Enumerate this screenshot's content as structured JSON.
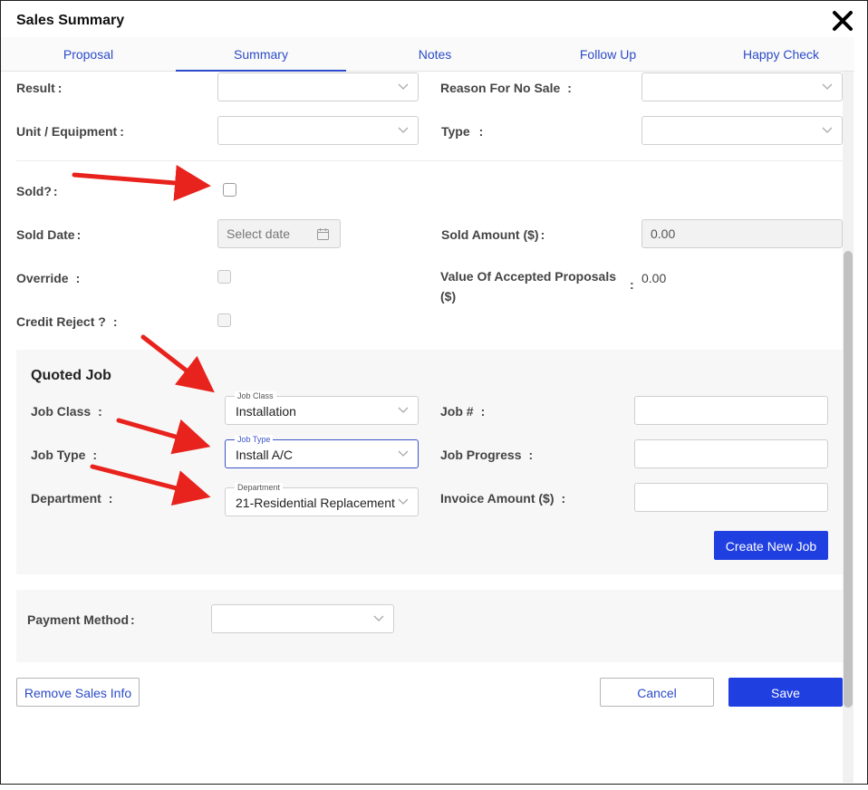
{
  "header": {
    "title": "Sales Summary",
    "close_icon": "close-icon"
  },
  "tabs": [
    {
      "label": "Proposal"
    },
    {
      "label": "Summary",
      "active": true
    },
    {
      "label": "Notes"
    },
    {
      "label": "Follow Up"
    },
    {
      "label": "Happy Check"
    }
  ],
  "form": {
    "result_label": "Result",
    "reason_label": "Reason For No Sale",
    "unit_label": "Unit / Equipment",
    "type_label": "Type",
    "sold_label": "Sold?",
    "sold_date_label": "Sold Date",
    "sold_date_placeholder": "Select date",
    "sold_amount_label": "Sold Amount ($)",
    "sold_amount_value": "0.00",
    "override_label": "Override",
    "value_accepted_label_1": "Value Of Accepted Proposals",
    "value_accepted_label_2": "($)",
    "value_accepted_value": "0.00",
    "credit_reject_label": "Credit Reject ?",
    "colon": ":"
  },
  "quoted_job": {
    "title": "Quoted Job",
    "job_class_label": "Job Class",
    "job_class_float": "Job Class",
    "job_class_value": "Installation",
    "job_type_label": "Job Type",
    "job_type_float": "Job Type",
    "job_type_value": "Install A/C",
    "department_label": "Department",
    "department_float": "Department",
    "department_value": "21-Residential Replacement",
    "job_no_label": "Job #",
    "job_progress_label": "Job Progress",
    "invoice_amount_label": "Invoice Amount ($)",
    "create_button": "Create New Job"
  },
  "payment": {
    "label": "Payment Method"
  },
  "footer": {
    "remove_button": "Remove Sales Info",
    "cancel_button": "Cancel",
    "save_button": "Save"
  },
  "colors": {
    "accent": "#1f3fe0",
    "tab_text": "#2b4bc8",
    "annotation_arrow": "#e8221c"
  }
}
